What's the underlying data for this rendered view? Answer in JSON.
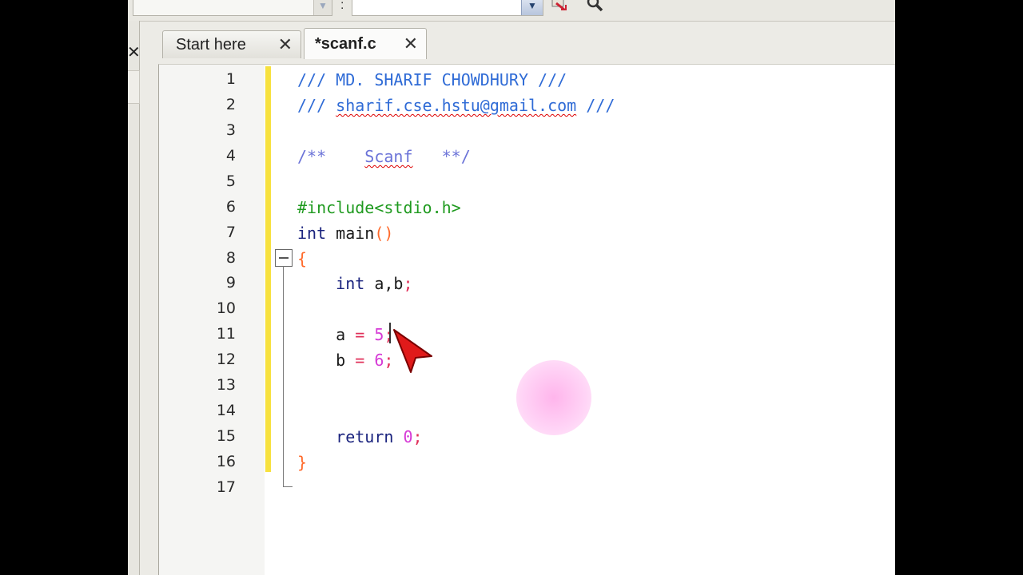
{
  "toolbar": {
    "separator": ":",
    "combo_arrow": "▼"
  },
  "left_panel": {
    "close_glyph": "✕"
  },
  "tabs": [
    {
      "label": "Start here",
      "close": "✕",
      "active": false
    },
    {
      "label": "*scanf.c",
      "close": "✕",
      "active": true
    }
  ],
  "editor": {
    "line_numbers": [
      "1",
      "2",
      "3",
      "4",
      "5",
      "6",
      "7",
      "8",
      "9",
      "10",
      "11",
      "12",
      "13",
      "14",
      "15",
      "16",
      "17"
    ],
    "lines": {
      "l1": "/// MD. SHARIF CHOWDHURY ///",
      "l2a": "/// ",
      "l2b": "sharif.cse.hstu@gmail.com",
      "l2c": " ///",
      "l4a": "/**    ",
      "l4b": "Scanf",
      "l4c": "   **/",
      "l6": "#include<stdio.h>",
      "l7a": "int",
      "l7b": " main",
      "l7c": "()",
      "l8": "{",
      "l9a": "    int",
      "l9b": " a,b",
      "l9c": ";",
      "l11a": "    a ",
      "l11b": "=",
      "l11c": " 5",
      "l11d": ";",
      "l12a": "    b ",
      "l12b": "=",
      "l12c": " 6",
      "l12d": ";",
      "l15a": "    return",
      "l15b": " 0",
      "l15c": ";",
      "l16": "}"
    },
    "colors": {
      "comment": "#2f6bd6",
      "preprocessor": "#1f9a1f",
      "keyword": "#1a237e",
      "operator": "#e0305a",
      "number": "#d63bd6",
      "brace": "#ff6a2b",
      "change_bar": "#f7e13e"
    }
  }
}
